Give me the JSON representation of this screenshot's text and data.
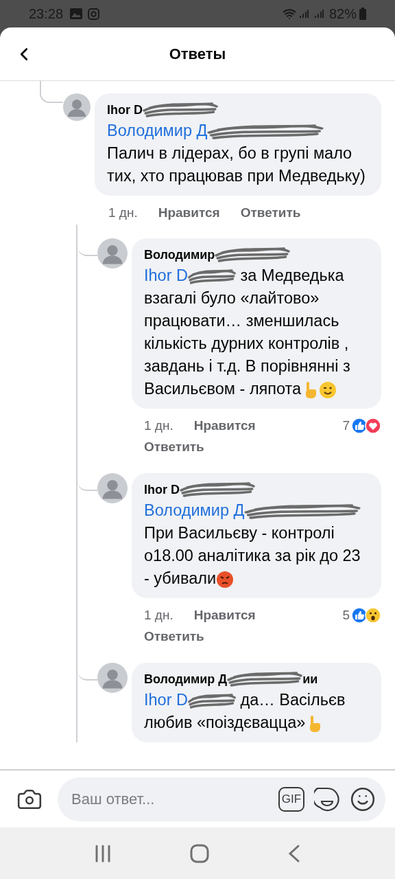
{
  "status_bar": {
    "time": "23:28",
    "battery": "82%"
  },
  "header": {
    "title": "Ответы"
  },
  "comments": [
    {
      "author": "Ihor D",
      "mention": "Володимир Д",
      "mention_inline": false,
      "text": "Палич в лідерах, бо в групі мало тих, хто працював при Медведьку)",
      "time": "1 дн.",
      "like": "Нравится",
      "reply": "Ответить",
      "children": [
        {
          "author": "Володимир",
          "mention": "Ihor D",
          "mention_inline": true,
          "text": "за Медведька взагалі було «лайтово» працювати… зменшилась кількість дурних контролів , завдань і т.д. В порівнянні з Васильєвом - ляпота",
          "emojis": [
            {
              "kind": "point"
            },
            {
              "kind": "wink"
            }
          ],
          "time": "1 дн.",
          "like": "Нравится",
          "reply": "Ответить",
          "reaction_count": "7",
          "reactions": [
            {
              "kind": "like"
            },
            {
              "kind": "love"
            }
          ]
        },
        {
          "author": "Ihor D",
          "mention": "Володимир Д",
          "mention_inline": false,
          "text": "При Васильєву - контролі о18.00 аналітика за рік до 23 - убивали",
          "emojis": [
            {
              "kind": "angry"
            }
          ],
          "time": "1 дн.",
          "like": "Нравится",
          "reply": "Ответить",
          "reaction_count": "5",
          "reactions": [
            {
              "kind": "like"
            },
            {
              "kind": "wow"
            }
          ]
        },
        {
          "author": "Володимир Д",
          "name_end": "ии",
          "mention": "Ihor D",
          "mention_inline": true,
          "text": "да… Васільєв любив «поіздєвацца»",
          "emojis": [
            {
              "kind": "point"
            }
          ]
        }
      ]
    }
  ],
  "composer": {
    "placeholder": "Ваш ответ...",
    "gif_label": "GIF"
  }
}
